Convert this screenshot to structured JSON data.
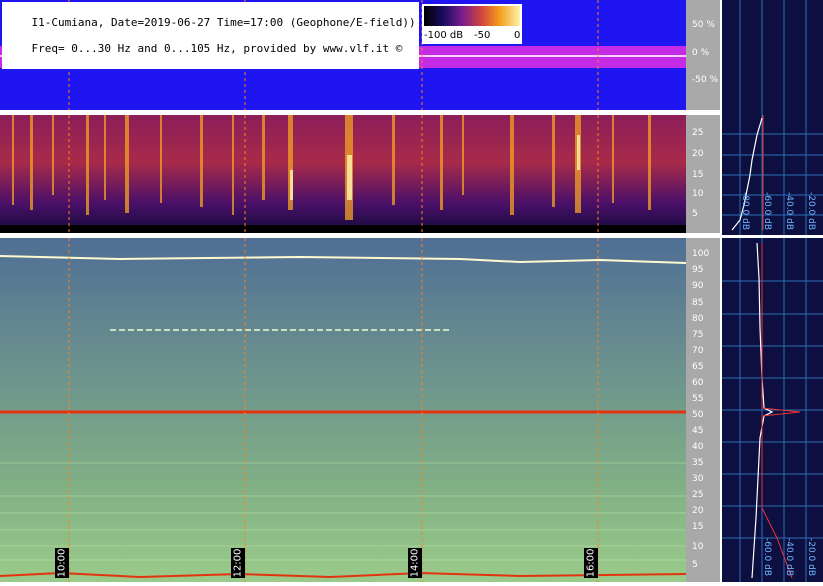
{
  "header": {
    "line1": "I1-Cumiana, Date=2019-06-27 Time=17:00 (Geophone/E-field))",
    "line2": "Freq= 0...30 Hz and 0...105 Hz, provided by www.vlf.it ©"
  },
  "colorbar": {
    "labels": [
      "-100 dB",
      "-50",
      "0"
    ]
  },
  "top_axis": {
    "labels": [
      "50 %",
      "0 %",
      "-50 %"
    ]
  },
  "mid_axis": {
    "labels": [
      "25",
      "20",
      "15",
      "10",
      "5"
    ]
  },
  "bot_axis": {
    "labels": [
      "100",
      "95",
      "90",
      "85",
      "80",
      "75",
      "70",
      "65",
      "60",
      "55",
      "50",
      "45",
      "40",
      "35",
      "30",
      "25",
      "20",
      "15",
      "10",
      "5"
    ]
  },
  "time_marks": [
    "10:00",
    "12:00",
    "14:00",
    "16:00"
  ],
  "right_top_labels": [
    "-60.0 dB",
    "-40.0 dB",
    "-20.0 dB",
    "-80.0 dB"
  ],
  "right_bot_labels": [
    "-40.0 dB",
    "-20.0 dB",
    "-60.0 dB"
  ]
}
